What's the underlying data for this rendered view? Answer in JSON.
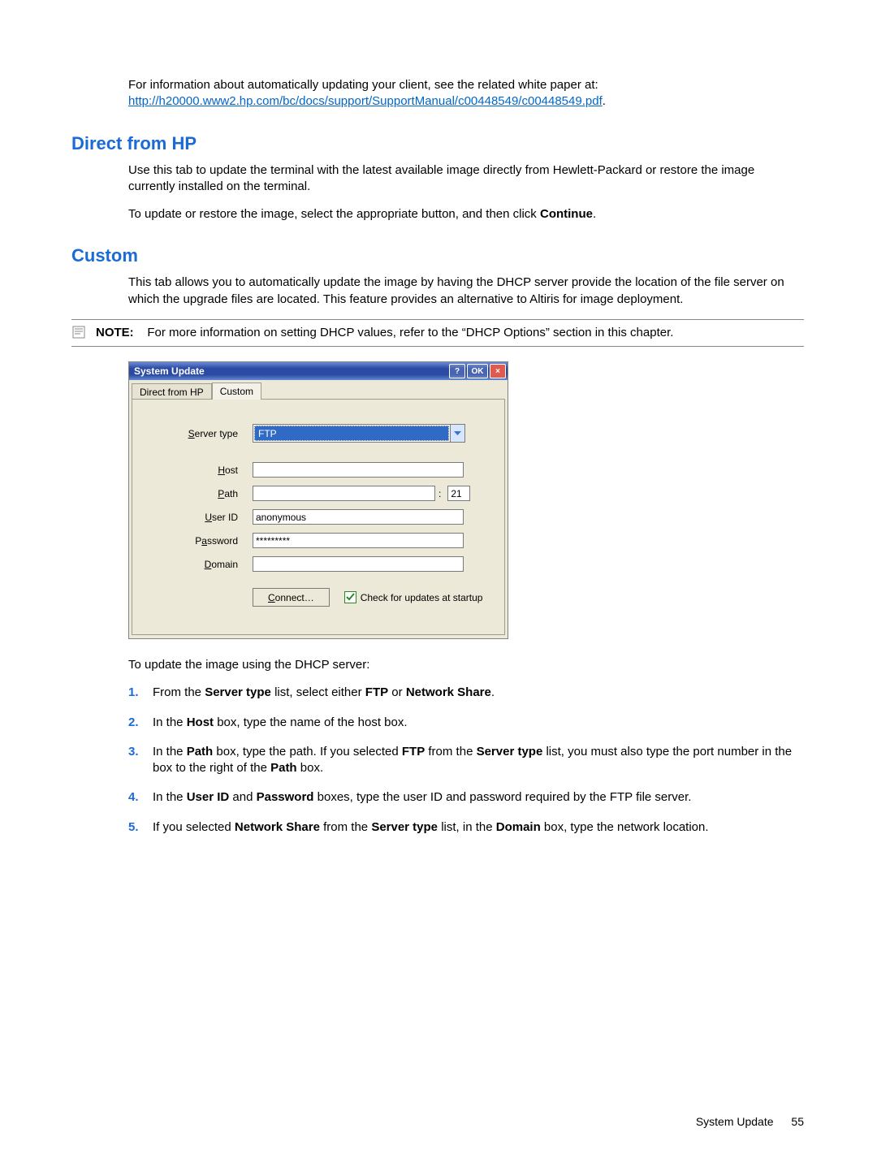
{
  "intro": {
    "p1_a": "For information about automatically updating your client, see the related white paper at: ",
    "link": "http://h20000.www2.hp.com/bc/docs/support/SupportManual/c00448549/c00448549.pdf",
    "p1_b": "."
  },
  "section1": {
    "heading": "Direct from HP",
    "p1": "Use this tab to update the terminal with the latest available image directly from Hewlett-Packard or restore the image currently installed on the terminal.",
    "p2_a": "To update or restore the image, select the appropriate button, and then click ",
    "p2_b": "Continue",
    "p2_c": "."
  },
  "section2": {
    "heading": "Custom",
    "p1": "This tab allows you to automatically update the image by having the DHCP server provide the location of the file server on which the upgrade files are located. This feature provides an alternative to Altiris for image deployment."
  },
  "note": {
    "label": "NOTE:",
    "text": "For more information on setting DHCP values, refer to the “DHCP Options” section in this chapter."
  },
  "dialog": {
    "title": "System Update",
    "help": "?",
    "ok": "OK",
    "close": "×",
    "tab_direct": "Direct from HP",
    "tab_custom": "Custom",
    "labels": {
      "server_type_pre": "S",
      "server_type_rest": "erver type",
      "host_pre": "H",
      "host_rest": "ost",
      "path_pre": "P",
      "path_rest": "ath",
      "user_pre": "U",
      "user_rest": "ser ID",
      "password_pre": "P",
      "password_mid": "a",
      "password_rest": "ssword",
      "domain_pre": "D",
      "domain_rest": "omain"
    },
    "values": {
      "server_type": "FTP",
      "host": "",
      "path": "",
      "port": "21",
      "user_id": "anonymous",
      "password": "*********",
      "domain": ""
    },
    "connect_pre": "C",
    "connect_rest": "onnect…",
    "checkbox_pre": "Chec",
    "checkbox_mid": "k",
    "checkbox_rest": " for updates at startup",
    "checkbox_checked": true,
    "colon": ":"
  },
  "after_dialog": "To update the image using the DHCP server:",
  "steps": [
    {
      "pre": "From the ",
      "b1": "Server type",
      "mid": " list, select either ",
      "b2": "FTP",
      "mid2": " or ",
      "b3": "Network Share",
      "end": "."
    },
    {
      "pre": "In the ",
      "b1": "Host",
      "mid": " box, type the name of the host box.",
      "b2": "",
      "mid2": "",
      "b3": "",
      "end": ""
    },
    {
      "pre": "In the ",
      "b1": "Path",
      "mid": " box, type the path. If you selected ",
      "b2": "FTP",
      "mid2": " from the ",
      "b3": "Server type",
      "mid3": " list, you must also type the port number in the box to the right of the ",
      "b4": "Path",
      "end": " box."
    },
    {
      "pre": "In the ",
      "b1": "User ID",
      "mid": " and ",
      "b2": "Password",
      "mid2": " boxes, type the user ID and password required by the FTP file server.",
      "b3": "",
      "end": ""
    },
    {
      "pre": "If you selected ",
      "b1": "Network Share",
      "mid": " from the ",
      "b2": "Server type",
      "mid2": " list, in the ",
      "b3": "Domain",
      "mid3": " box, type the network location.",
      "b4": "",
      "end": ""
    }
  ],
  "footer": {
    "label": "System Update",
    "page": "55"
  }
}
